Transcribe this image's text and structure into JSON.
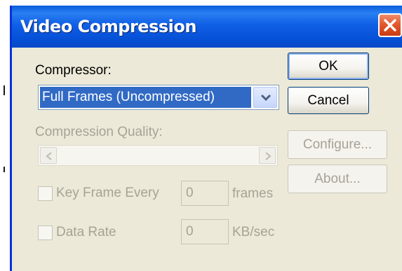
{
  "window": {
    "title": "Video Compression",
    "close_icon": "close-icon"
  },
  "compressor": {
    "label": "Compressor:",
    "selected": "Full Frames (Uncompressed)",
    "dropdown_icon": "chevron-down-icon"
  },
  "quality": {
    "label": "Compression Quality:",
    "left_icon": "chevron-left-icon",
    "right_icon": "chevron-right-icon"
  },
  "key_frame": {
    "label": "Key Frame Every",
    "value": "0",
    "unit": "frames",
    "checked": false
  },
  "data_rate": {
    "label": "Data Rate",
    "value": "0",
    "unit": "KB/sec",
    "checked": false
  },
  "buttons": {
    "ok": "OK",
    "cancel": "Cancel",
    "configure": "Configure...",
    "about": "About..."
  },
  "colors": {
    "title_bar": "#0a5fdc",
    "selection": "#316ac5",
    "dialog_face": "#ece9d8",
    "close_button": "#e35a2e",
    "disabled_text": "#a6a396"
  }
}
